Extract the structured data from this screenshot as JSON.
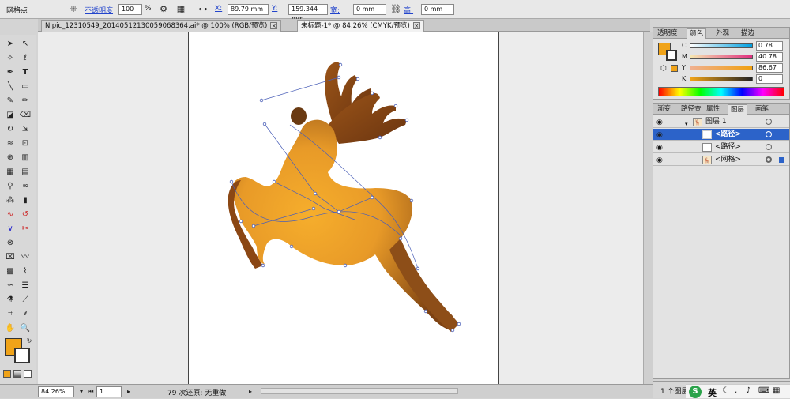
{
  "control_bar": {
    "mode_label": "网格点",
    "opacity_label": "不透明度",
    "opacity_value": "100",
    "opacity_unit": "%",
    "x_label": "X:",
    "x_value": "89.79 mm",
    "y_label": "Y:",
    "y_value": "159.344 mm",
    "w_label": "宽:",
    "w_value": "0 mm",
    "h_label": "高:",
    "h_value": "0 mm"
  },
  "tabs": [
    {
      "label": "Nipic_12310549_20140512130059068364.ai* @ 100% (RGB/预览)",
      "active": false
    },
    {
      "label": "未标题-1* @ 84.26% (CMYK/预览)",
      "active": true
    }
  ],
  "status": {
    "zoom": "84.26%",
    "page": "1",
    "message": "79 次还原; 无重做"
  },
  "color_panel": {
    "tabs": [
      "透明度",
      "颜色",
      "外观",
      "描边"
    ],
    "active_tab": "颜色",
    "channels": [
      {
        "name": "C",
        "value": "0.78"
      },
      {
        "name": "M",
        "value": "40.78"
      },
      {
        "name": "Y",
        "value": "86.67"
      },
      {
        "name": "K",
        "value": "0"
      }
    ],
    "fill_color": "#f0a318"
  },
  "layers_panel": {
    "tabs": [
      "渐变",
      "路径查",
      "属性",
      "图层",
      "画笔"
    ],
    "active_tab": "图层",
    "rows": [
      {
        "name": "图层 1",
        "indent": 0,
        "selected": false
      },
      {
        "name": "<路径>",
        "indent": 1,
        "selected": true
      },
      {
        "name": "<路径>",
        "indent": 1,
        "selected": false
      },
      {
        "name": "<网格>",
        "indent": 1,
        "selected": false
      }
    ],
    "footer": "1 个图层"
  },
  "taskbar": {
    "ime": "英"
  },
  "artwork": {
    "subject": "leaping reindeer mesh gradient",
    "colors": {
      "body_light": "#f4a825",
      "body_dark": "#8b4a14",
      "antler": "#7a3c12",
      "path": "#4a5fb8"
    }
  }
}
